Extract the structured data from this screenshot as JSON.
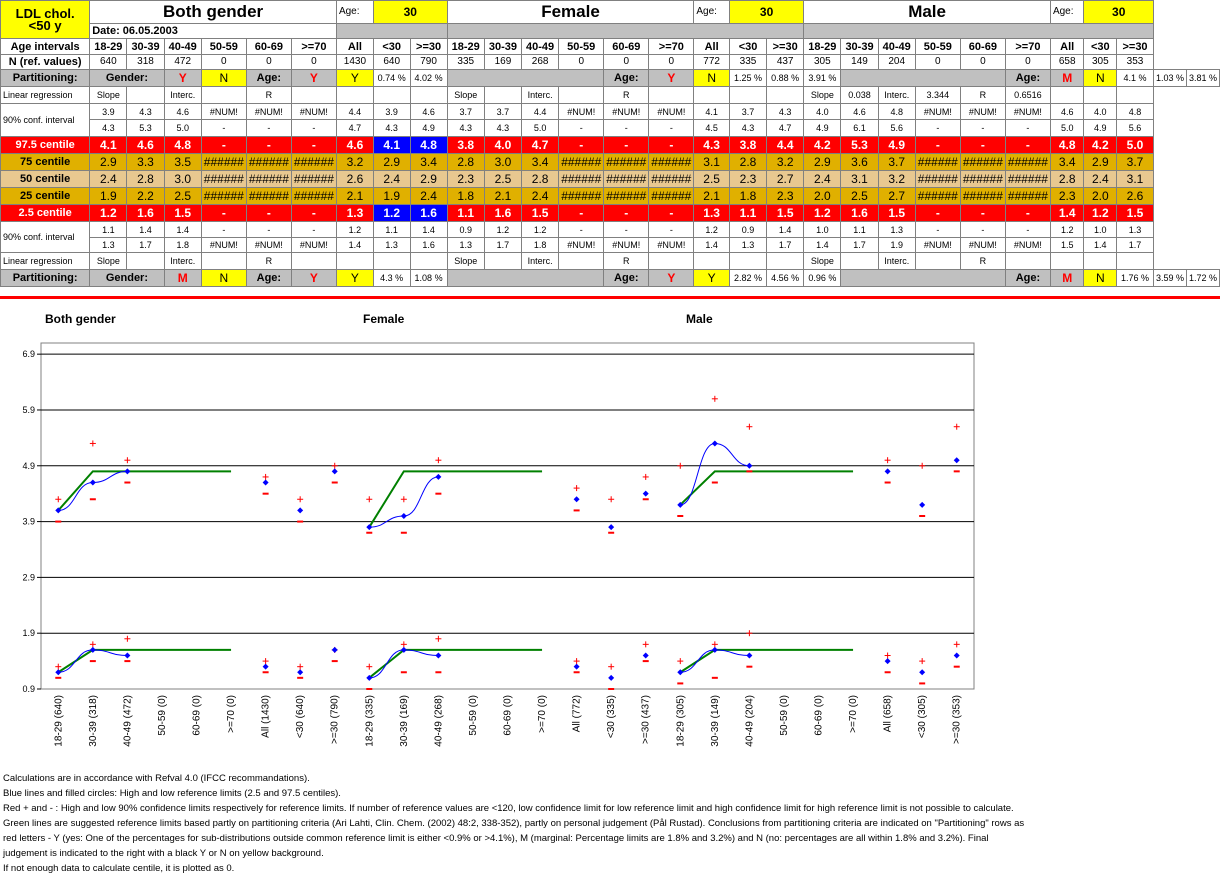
{
  "header": {
    "title_line1": "LDL chol.",
    "title_line2": "<50 y",
    "date": "Date: 06.05.2003",
    "groups": [
      "Both gender",
      "Female",
      "Male"
    ],
    "age_label": "Age:",
    "age_value": "30"
  },
  "rows": {
    "age_intervals_label": "Age intervals",
    "n_label": "N (ref. values)",
    "partitioning_label": "Partitioning:",
    "linreg_label": "Linear regression",
    "ci_label": "90% conf. interval",
    "centiles": [
      "97.5 centile",
      "75 centile",
      "50 centile",
      "25 centile",
      "2.5 centile"
    ]
  },
  "columns": [
    "18-29",
    "30-39",
    "40-49",
    "50-59",
    "60-69",
    ">=70",
    "All",
    "<30",
    ">=30"
  ],
  "table": {
    "both": {
      "n": [
        "640",
        "318",
        "472",
        "0",
        "0",
        "0",
        "1430",
        "640",
        "790"
      ],
      "part_top": [
        "Gender:",
        "Y",
        "N",
        "Age:",
        "Y",
        "Y",
        "0.74 %",
        "4.02 %"
      ],
      "linreg_top": [
        "Slope",
        "",
        "Interc.",
        "",
        "R",
        "",
        "",
        "",
        ""
      ],
      "ci_top_a": [
        "3.9",
        "4.3",
        "4.6",
        "#NUM!",
        "#NUM!",
        "#NUM!",
        "4.4",
        "3.9",
        "4.6"
      ],
      "ci_top_b": [
        "4.3",
        "5.3",
        "5.0",
        "-",
        "-",
        "-",
        "4.7",
        "4.3",
        "4.9"
      ],
      "c975": [
        "4.1",
        "4.6",
        "4.8",
        "-",
        "-",
        "-",
        "4.6",
        "4.1",
        "4.8"
      ],
      "c75": [
        "2.9",
        "3.3",
        "3.5",
        "######",
        "######",
        "######",
        "3.2",
        "2.9",
        "3.4"
      ],
      "c50": [
        "2.4",
        "2.8",
        "3.0",
        "######",
        "######",
        "######",
        "2.6",
        "2.4",
        "2.9"
      ],
      "c25": [
        "1.9",
        "2.2",
        "2.5",
        "######",
        "######",
        "######",
        "2.1",
        "1.9",
        "2.4"
      ],
      "c25b": [
        "1.2",
        "1.6",
        "1.5",
        "-",
        "-",
        "-",
        "1.3",
        "1.2",
        "1.6"
      ],
      "ci_bot_a": [
        "1.1",
        "1.4",
        "1.4",
        "-",
        "-",
        "-",
        "1.2",
        "1.1",
        "1.4"
      ],
      "ci_bot_b": [
        "1.3",
        "1.7",
        "1.8",
        "#NUM!",
        "#NUM!",
        "#NUM!",
        "1.4",
        "1.3",
        "1.6"
      ],
      "linreg_bot": [
        "Slope",
        "",
        "Interc.",
        "",
        "R",
        "",
        "",
        "",
        ""
      ],
      "part_bot": [
        "Gender:",
        "M",
        "N",
        "Age:",
        "Y",
        "Y",
        "4.3 %",
        "1.08 %"
      ]
    },
    "female": {
      "n": [
        "335",
        "169",
        "268",
        "0",
        "0",
        "0",
        "772",
        "335",
        "437"
      ],
      "part_top": [
        "Age:",
        "Y",
        "N",
        "1.25 %",
        "0.88 %",
        "3.91 %"
      ],
      "linreg_top": [
        "Slope",
        "",
        "Interc.",
        "",
        "R",
        "",
        "",
        "",
        ""
      ],
      "ci_top_a": [
        "3.7",
        "3.7",
        "4.4",
        "#NUM!",
        "#NUM!",
        "#NUM!",
        "4.1",
        "3.7",
        "4.3"
      ],
      "ci_top_b": [
        "4.3",
        "4.3",
        "5.0",
        "-",
        "-",
        "-",
        "4.5",
        "4.3",
        "4.7"
      ],
      "c975": [
        "3.8",
        "4.0",
        "4.7",
        "-",
        "-",
        "-",
        "4.3",
        "3.8",
        "4.4"
      ],
      "c75": [
        "2.8",
        "3.0",
        "3.4",
        "######",
        "######",
        "######",
        "3.1",
        "2.8",
        "3.2"
      ],
      "c50": [
        "2.3",
        "2.5",
        "2.8",
        "######",
        "######",
        "######",
        "2.5",
        "2.3",
        "2.7"
      ],
      "c25": [
        "1.8",
        "2.1",
        "2.4",
        "######",
        "######",
        "######",
        "2.1",
        "1.8",
        "2.3"
      ],
      "c25b": [
        "1.1",
        "1.6",
        "1.5",
        "-",
        "-",
        "-",
        "1.3",
        "1.1",
        "1.5"
      ],
      "ci_bot_a": [
        "0.9",
        "1.2",
        "1.2",
        "-",
        "-",
        "-",
        "1.2",
        "0.9",
        "1.4"
      ],
      "ci_bot_b": [
        "1.3",
        "1.7",
        "1.8",
        "#NUM!",
        "#NUM!",
        "#NUM!",
        "1.4",
        "1.3",
        "1.7"
      ],
      "linreg_bot": [
        "Slope",
        "",
        "Interc.",
        "",
        "R",
        "",
        "",
        "",
        ""
      ],
      "part_bot": [
        "Age:",
        "Y",
        "Y",
        "2.82 %",
        "4.56 %",
        "0.96 %"
      ]
    },
    "male": {
      "n": [
        "305",
        "149",
        "204",
        "0",
        "0",
        "0",
        "658",
        "305",
        "353"
      ],
      "part_top": [
        "Age:",
        "M",
        "N",
        "4.1 %",
        "1.03 %",
        "3.81 %"
      ],
      "linreg_top": [
        "Slope",
        "0.038",
        "Interc.",
        "3.344",
        "R",
        "0.6516",
        "",
        "",
        ""
      ],
      "ci_top_a": [
        "4.0",
        "4.6",
        "4.8",
        "#NUM!",
        "#NUM!",
        "#NUM!",
        "4.6",
        "4.0",
        "4.8"
      ],
      "ci_top_b": [
        "4.9",
        "6.1",
        "5.6",
        "-",
        "-",
        "-",
        "5.0",
        "4.9",
        "5.6"
      ],
      "c975": [
        "4.2",
        "5.3",
        "4.9",
        "-",
        "-",
        "-",
        "4.8",
        "4.2",
        "5.0"
      ],
      "c75": [
        "2.9",
        "3.6",
        "3.7",
        "######",
        "######",
        "######",
        "3.4",
        "2.9",
        "3.7"
      ],
      "c50": [
        "2.4",
        "3.1",
        "3.2",
        "######",
        "######",
        "######",
        "2.8",
        "2.4",
        "3.1"
      ],
      "c25": [
        "2.0",
        "2.5",
        "2.7",
        "######",
        "######",
        "######",
        "2.3",
        "2.0",
        "2.6"
      ],
      "c25b": [
        "1.2",
        "1.6",
        "1.5",
        "-",
        "-",
        "-",
        "1.4",
        "1.2",
        "1.5"
      ],
      "ci_bot_a": [
        "1.0",
        "1.1",
        "1.3",
        "-",
        "-",
        "-",
        "1.2",
        "1.0",
        "1.3"
      ],
      "ci_bot_b": [
        "1.4",
        "1.7",
        "1.9",
        "#NUM!",
        "#NUM!",
        "#NUM!",
        "1.5",
        "1.4",
        "1.7"
      ],
      "linreg_bot": [
        "Slope",
        "",
        "Interc.",
        "",
        "R",
        "",
        "",
        "",
        ""
      ],
      "part_bot": [
        "Age:",
        "M",
        "N",
        "1.76 %",
        "3.59 %",
        "1.72 %"
      ]
    }
  },
  "chart_data": {
    "type": "scatter",
    "titles": [
      "Both gender",
      "Female",
      "Male"
    ],
    "yticks": [
      "0.9",
      "1.9",
      "2.9",
      "3.9",
      "4.9",
      "5.9",
      "6.9"
    ],
    "ylim": [
      0.9,
      7.1
    ],
    "categories": [
      "18-29 (640)",
      "30-39 (318)",
      "40-49 (472)",
      "50-59 (0)",
      "60-69 (0)",
      ">=70 (0)",
      "All (1430)",
      "<30 (640)",
      ">=30 (790)",
      "18-29 (335)",
      "30-39 (169)",
      "40-49 (268)",
      "50-59 (0)",
      "60-69 (0)",
      ">=70 (0)",
      "All (772)",
      "<30 (335)",
      ">=30 (437)",
      "18-29 (305)",
      "30-39 (149)",
      "40-49 (204)",
      "50-59 (0)",
      "60-69 (0)",
      ">=70 (0)",
      "All (658)",
      "<30 (305)",
      ">=30 (353)"
    ],
    "upper_centile": [
      4.1,
      4.6,
      4.8,
      null,
      null,
      null,
      4.6,
      4.1,
      4.8,
      3.8,
      4.0,
      4.7,
      null,
      null,
      null,
      4.3,
      3.8,
      4.4,
      4.2,
      5.3,
      4.9,
      null,
      null,
      null,
      4.8,
      4.2,
      5.0
    ],
    "upper_ci_high": [
      4.3,
      5.3,
      5.0,
      null,
      null,
      null,
      4.7,
      4.3,
      4.9,
      4.3,
      4.3,
      5.0,
      null,
      null,
      null,
      4.5,
      4.3,
      4.7,
      4.9,
      6.1,
      5.6,
      null,
      null,
      null,
      5.0,
      4.9,
      5.6
    ],
    "upper_ci_low": [
      3.9,
      4.3,
      4.6,
      null,
      null,
      null,
      4.4,
      3.9,
      4.6,
      3.7,
      3.7,
      4.4,
      null,
      null,
      null,
      4.1,
      3.7,
      4.3,
      4.0,
      4.6,
      4.8,
      null,
      null,
      null,
      4.6,
      4.0,
      4.8
    ],
    "lower_centile": [
      1.2,
      1.6,
      1.5,
      null,
      null,
      null,
      1.3,
      1.2,
      1.6,
      1.1,
      1.6,
      1.5,
      null,
      null,
      null,
      1.3,
      1.1,
      1.5,
      1.2,
      1.6,
      1.5,
      null,
      null,
      null,
      1.4,
      1.2,
      1.5
    ],
    "lower_ci_high": [
      1.3,
      1.7,
      1.8,
      null,
      null,
      null,
      1.4,
      1.3,
      1.6,
      1.3,
      1.7,
      1.8,
      null,
      null,
      null,
      1.4,
      1.3,
      1.7,
      1.4,
      1.7,
      1.9,
      null,
      null,
      null,
      1.5,
      1.4,
      1.7
    ],
    "lower_ci_low": [
      1.1,
      1.4,
      1.4,
      null,
      null,
      null,
      1.2,
      1.1,
      1.4,
      0.9,
      1.2,
      1.2,
      null,
      null,
      null,
      1.2,
      0.9,
      1.4,
      1.0,
      1.1,
      1.3,
      null,
      null,
      null,
      1.2,
      1.0,
      1.3
    ],
    "suggested_upper": 4.8,
    "suggested_lower": 1.6,
    "colors": {
      "centile": "#0000ff",
      "ci": "#ff0000",
      "suggested": "#008000",
      "grid": "#000000"
    }
  },
  "notes": [
    "Calculations are in accordance with Refval 4.0 (IFCC recommandations).",
    "Blue lines and filled circles: High and low reference limits (2.5 and 97.5 centiles).",
    "Red + and - : High and low 90% confidence limits respectively for reference limits. If number of reference values are <120, low confidence limit for low reference limit and high confidence limit for high reference limit is not possible to calculate.",
    "Green lines are suggested reference limits based partly on partitioning criteria (Ari Lahti, Clin. Chem. (2002) 48:2, 338-352), partly on personal judgement (Pål Rustad). Conclusions from partitioning criteria are indicated on \"Partitioning\" rows as red letters - Y (yes: One of the percentages for sub-distributions outside common reference limit is either <0.9% or >4.1%), M (marginal: Percentage limits are 1.8% and 3.2%) and N (no:  percentages are all within 1.8% and 3.2%). Final judgement is indicated to the right with a black Y or N on yellow background.",
    "If not enough data to calculate centile, it is plotted as 0."
  ]
}
